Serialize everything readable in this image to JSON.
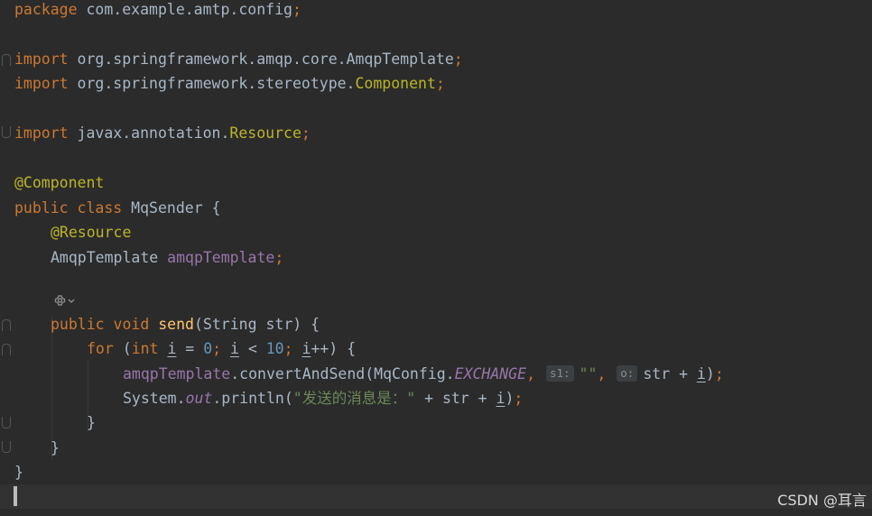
{
  "code": {
    "l1_kw": "package",
    "l1_pkg": " com.example.amtp.config",
    "l3_kw": "import",
    "l3_path": " org.springframework.amqp.core.AmqpTemplate",
    "l4_kw": "import",
    "l4_path": " org.springframework.stereotype.",
    "l4_cls": "Component",
    "l6_kw": "import",
    "l6_path": " javax.annotation.",
    "l6_cls": "Resource",
    "l8_ann": "@Component",
    "l9_kw": "public class",
    "l9_name": " MqSender {",
    "l10_ann": "@Resource",
    "l11_type": "AmqpTemplate ",
    "l11_field": "amqpTemplate",
    "l13_kw1": "public",
    "l13_kw2": "void",
    "l13_fn": "send",
    "l13_params": "(String str) {",
    "l14_for": "for",
    "l14_open": " (",
    "l14_int": "int",
    "l14_i1": "i",
    "l14_eq": " = ",
    "l14_zero": "0",
    "l14_i2": "i",
    "l14_lt": " < ",
    "l14_ten": "10",
    "l14_i3": "i",
    "l14_inc": "++) {",
    "l15_field": "amqpTemplate",
    "l15_call": ".convertAndSend(MqConfig.",
    "l15_const": "EXCHANGE",
    "l15_hint1": "s1:",
    "l15_str": "\"\"",
    "l15_hint2": "o:",
    "l15_rest": "str + ",
    "l15_i": "i",
    "l15_close": ")",
    "l16_sys": "System.",
    "l16_out": "out",
    "l16_println": ".println(",
    "l16_str": "\"发送的消息是：\"",
    "l16_rest": " + str + ",
    "l16_i": "i",
    "l16_close": ")",
    "close_brace": "}",
    "semicolon": ";",
    "comma": ","
  },
  "watermark": "CSDN @耳言",
  "icons": {
    "gutter_gear": "gear-chevron-icon",
    "fold": "fold-marker-icon"
  },
  "colors": {
    "background": "#2b2b2b",
    "keyword": "#cc7832",
    "annotation": "#bbb529",
    "field": "#9876aa",
    "number": "#6897bb",
    "string": "#6a8759",
    "function": "#ffc66d",
    "text": "#a9b7c6"
  }
}
